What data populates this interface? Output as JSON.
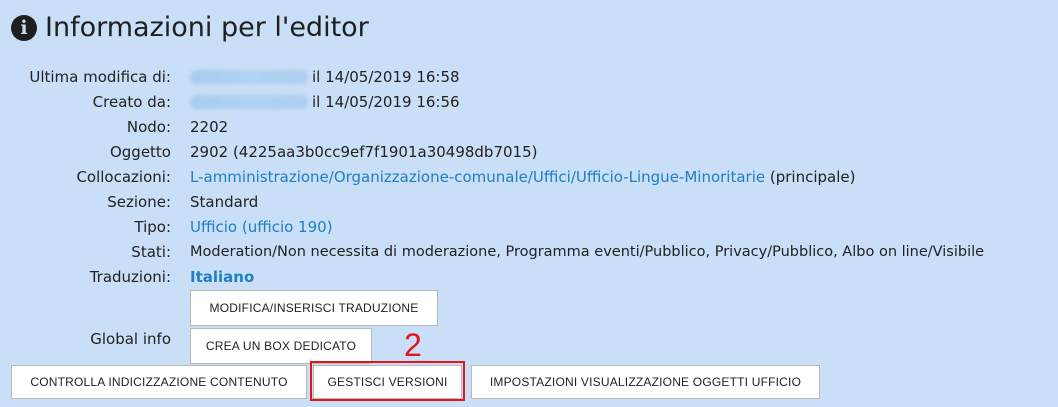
{
  "title": "Informazioni per l'editor",
  "rows": {
    "ultima_modifica": {
      "label": "Ultima modifica di:",
      "value": "il 14/05/2019 16:58"
    },
    "creato_da": {
      "label": "Creato da:",
      "value": "il 14/05/2019 16:56"
    },
    "nodo": {
      "label": "Nodo:",
      "value": "2202"
    },
    "oggetto": {
      "label": "Oggetto",
      "value": "2902 (4225aa3b0cc9ef7f1901a30498db7015)"
    },
    "collocazioni": {
      "label": "Collocazioni:",
      "link": "L-amministrazione/Organizzazione-comunale/Uffici/Ufficio-Lingue-Minoritarie",
      "suffix": " (principale)"
    },
    "sezione": {
      "label": "Sezione:",
      "value": "Standard"
    },
    "tipo": {
      "label": "Tipo:",
      "link": "Ufficio (ufficio 190)"
    },
    "stati": {
      "label": "Stati:",
      "value": "Moderation/Non necessita di moderazione, Programma eventi/Pubblico, Privacy/Pubblico, Albo on line/Visibile"
    },
    "traduzioni": {
      "label": "Traduzioni:",
      "link": "Italiano"
    },
    "global_info": {
      "label": "Global info"
    }
  },
  "buttons": {
    "modifica_traduzione": "MODIFICA/INSERISCI TRADUZIONE",
    "crea_box": "CREA UN BOX DEDICATO",
    "controlla_indicizzazione": "CONTROLLA INDICIZZAZIONE CONTENUTO",
    "gestisci_versioni": "GESTISCI VERSIONI",
    "impostazioni_visualizzazione": "IMPOSTAZIONI VISUALIZZAZIONE OGGETTI UFFICIO"
  },
  "annotation": {
    "step_number": "2",
    "color": "#e0161b"
  },
  "colors": {
    "background": "#c9def7",
    "link": "#1f7fc4"
  }
}
